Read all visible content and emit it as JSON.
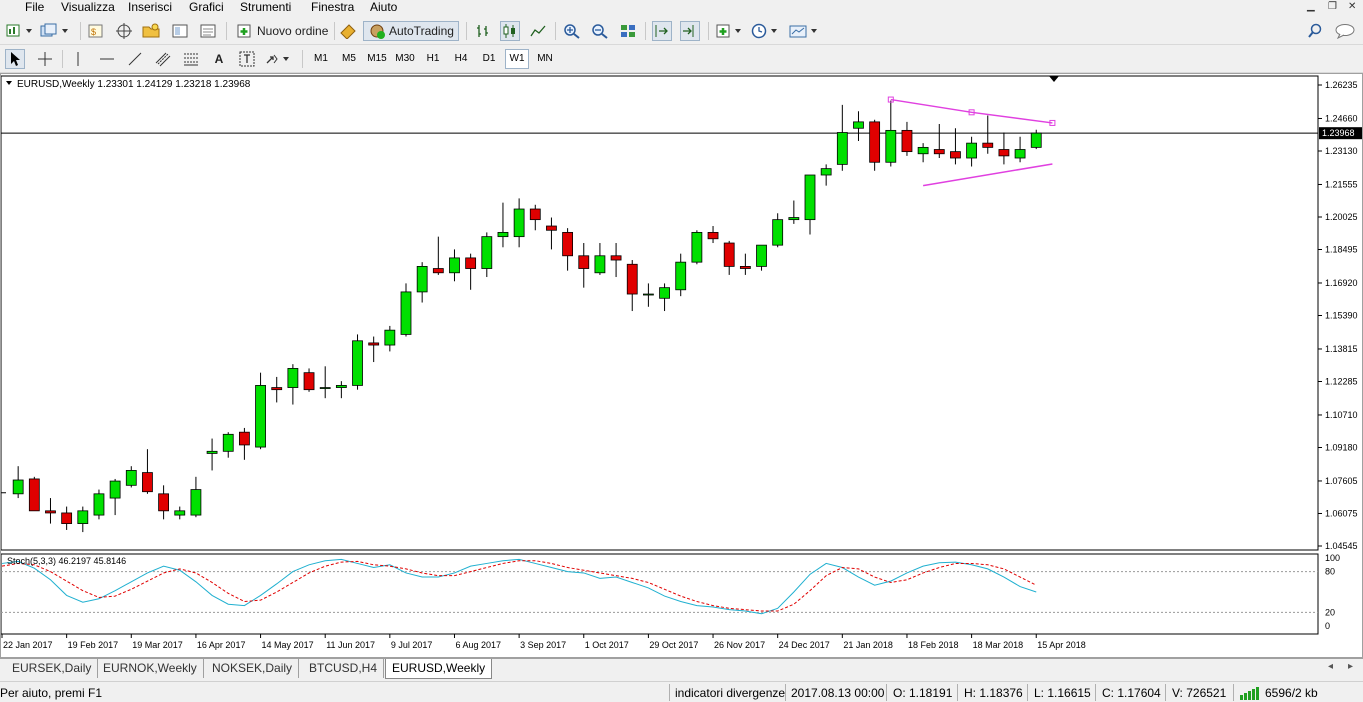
{
  "menu": [
    "File",
    "Visualizza",
    "Inserisci",
    "Grafici",
    "Strumenti",
    "Finestra",
    "Aiuto"
  ],
  "toolbar": {
    "new_order_label": "Nuovo ordine",
    "autotrading_label": "AutoTrading"
  },
  "timeframes": [
    "M1",
    "M5",
    "M15",
    "M30",
    "H1",
    "H4",
    "D1",
    "W1",
    "MN"
  ],
  "active_timeframe": "W1",
  "chart": {
    "header": "EURUSD,Weekly  1.23301 1.24129 1.23218 1.23968",
    "current_price_label": "1.23968",
    "price_ticks": [
      "1.26235",
      "1.24660",
      "1.23130",
      "1.21555",
      "1.20025",
      "1.18495",
      "1.16920",
      "1.15390",
      "1.13815",
      "1.12285",
      "1.10710",
      "1.09180",
      "1.07605",
      "1.06075",
      "1.04545"
    ],
    "date_labels": [
      "22 Jan 2017",
      "19 Feb 2017",
      "19 Mar 2017",
      "16 Apr 2017",
      "14 May 2017",
      "11 Jun 2017",
      "9 Jul 2017",
      "6 Aug 2017",
      "3 Sep 2017",
      "1 Oct 2017",
      "29 Oct 2017",
      "26 Nov 2017",
      "24 Dec 2017",
      "21 Jan 2018",
      "18 Feb 2018",
      "18 Mar 2018",
      "15 Apr 2018"
    ],
    "indicator_label": "Stoch(5,3,3) 46.2197 45.8146",
    "indicator_ticks": [
      "100",
      "80",
      "20",
      "0"
    ],
    "colors": {
      "bull": "#00e000",
      "bear": "#e00000",
      "triangle": "#e040e0",
      "k_line": "#20b0d0",
      "d_line": "#e00000"
    }
  },
  "tabs": [
    "EURSEK,Daily",
    "EURNOK,Weekly",
    "NOKSEK,Daily",
    "BTCUSD,H4",
    "EURUSD,Weekly"
  ],
  "active_tab": "EURUSD,Weekly",
  "status": {
    "help": "Per aiuto, premi F1",
    "profile": "indicatori divergenze",
    "datetime": "2017.08.13 00:00",
    "open": "O: 1.18191",
    "high": "H: 1.18376",
    "low": "L: 1.16615",
    "close": "C: 1.17604",
    "volume": "V: 726521",
    "traffic": "6596/2 kb"
  }
}
